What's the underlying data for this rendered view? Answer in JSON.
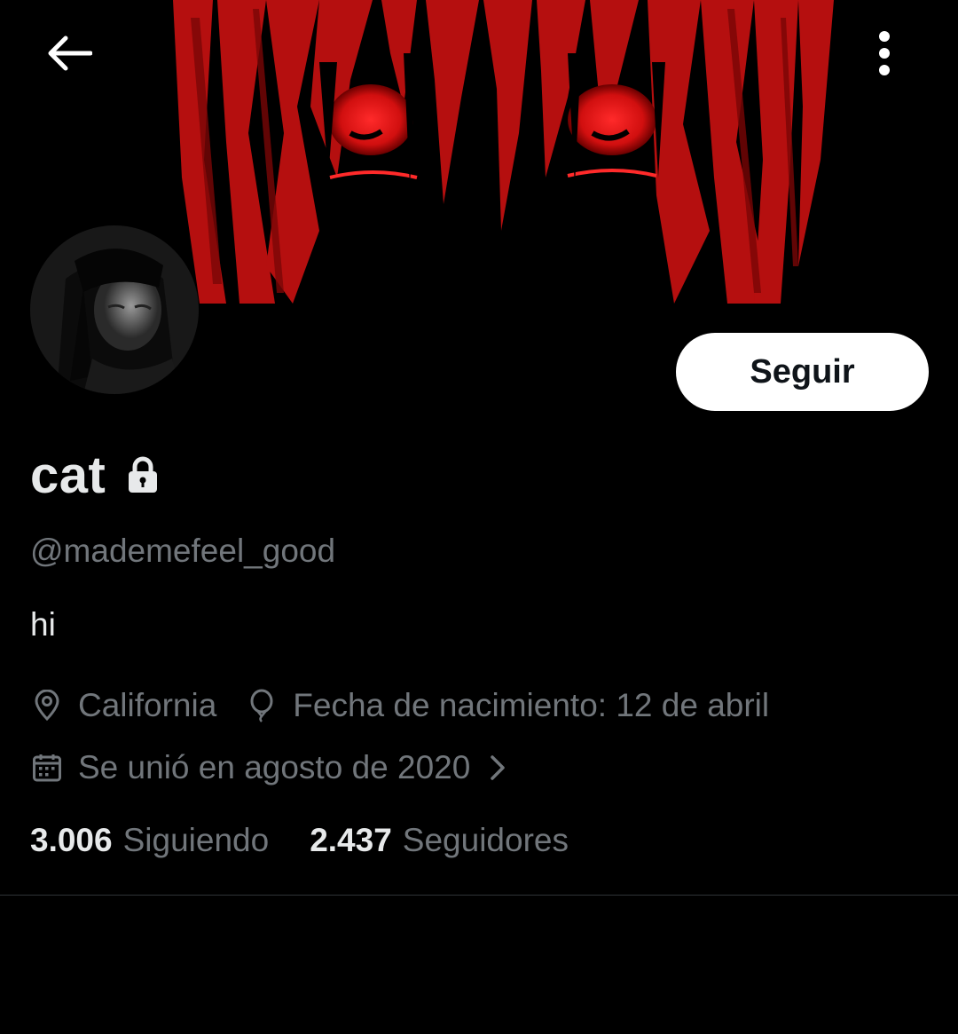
{
  "profile": {
    "display_name": "cat",
    "handle": "@mademefeel_good",
    "bio": "hi",
    "location": "California",
    "birthday": "Fecha de nacimiento: 12 de abril",
    "joined": "Se unió en agosto de 2020",
    "following_count": "3.006",
    "following_label": "Siguiendo",
    "followers_count": "2.437",
    "followers_label": "Seguidores"
  },
  "actions": {
    "follow_label": "Seguir"
  },
  "icons": {
    "back": "arrow-left-icon",
    "more": "more-vertical-icon",
    "lock": "lock-icon",
    "location": "location-pin-icon",
    "birthday": "balloon-icon",
    "joined": "calendar-icon",
    "chevron": "chevron-right-icon"
  },
  "colors": {
    "background": "#000000",
    "text_primary": "#e7e9ea",
    "text_secondary": "#71767b",
    "banner_accent": "#e01616",
    "follow_button_bg": "#ffffff",
    "follow_button_text": "#0f1419"
  }
}
